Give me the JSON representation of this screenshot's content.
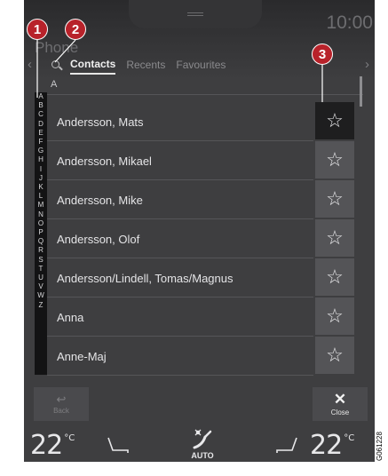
{
  "header": {
    "clock": "10:00",
    "app_title": "Phone"
  },
  "tabs": [
    {
      "label": "Contacts",
      "active": true
    },
    {
      "label": "Recents",
      "active": false
    },
    {
      "label": "Favourites",
      "active": false
    }
  ],
  "list": {
    "section_header": "A",
    "alphabet": [
      "A",
      "B",
      "C",
      "D",
      "E",
      "F",
      "G",
      "H",
      "I",
      "J",
      "K",
      "L",
      "M",
      "N",
      "O",
      "P",
      "Q",
      "R",
      "S",
      "T",
      "U",
      "V",
      "W",
      "Z"
    ],
    "contacts": [
      {
        "name": "Andersson, Mats",
        "favourite_icon": "star-outline-icon",
        "highlighted": true
      },
      {
        "name": "Andersson, Mikael",
        "favourite_icon": "star-outline-icon",
        "highlighted": false
      },
      {
        "name": "Andersson, Mike",
        "favourite_icon": "star-outline-icon",
        "highlighted": false
      },
      {
        "name": "Andersson, Olof",
        "favourite_icon": "star-outline-icon",
        "highlighted": false
      },
      {
        "name": "Andersson/Lindell, Tomas/Magnus",
        "favourite_icon": "star-outline-icon",
        "highlighted": false
      },
      {
        "name": "Anna",
        "favourite_icon": "star-outline-icon",
        "highlighted": false
      },
      {
        "name": "Anne-Maj",
        "favourite_icon": "star-outline-icon",
        "highlighted": false
      }
    ],
    "star_glyph": "☆"
  },
  "bottom": {
    "back_label": "Back",
    "back_icon": "↩",
    "close_label": "Close",
    "close_icon": "✕"
  },
  "climate": {
    "left_temp": "22",
    "right_temp": "22",
    "unit": "°C",
    "fan_label": "AUTO"
  },
  "callouts": [
    "1",
    "2",
    "3"
  ],
  "reference_code": "G061228",
  "colors": {
    "screen_bg": "#3e3e40",
    "callout_red": "#b8222a",
    "favourite_active_bg": "#1e1e1f"
  }
}
